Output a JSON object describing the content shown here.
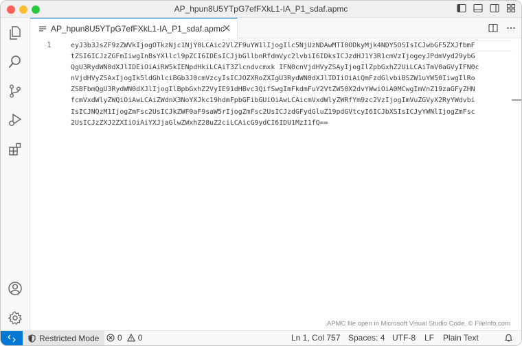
{
  "window": {
    "title": "AP_hpun8U5YTpG7efFXkL1-IA_P1_sdaf.apmc"
  },
  "tab": {
    "label": "AP_hpun8U5YTpG7efFXkL1-IA_P1_sdaf.apmc"
  },
  "editor": {
    "line_number": "1",
    "lines": [
      "eyJ3b3JsZF9zZWVkIjogOTkzNjc1NjY0LCAic2VlZF9uYW1lIjogIlc5NjUzNDAwMTI0ODkyMjk4NDY5OSIsICJwbGF5ZXJfbmF",
      "tZSI6ICJzZGFmIiwgInBsYXllcl9pZCI6IDEsICJjbGllbnRfdmVyc2lvbiI6IDksICJzdHJ1Y3R1cmVzIjogeyJPdmVyd29ybG",
      "QgU3RydWN0dXJlIDEiOiAiRW5kIENpdHkiLCAiT3Zlcndvcmxk IFN0cnVjdHVyZSAyIjogIlZpbGxhZ2UiLCAiTmV0aGVyIFN0c",
      "nVjdHVyZSAxIjogIk5ldGhlciBGb3J0cmVzcyIsICJOZXRoZXIgU3RydWN0dXJlIDIiOiAiQmFzdGlvbiBSZW1uYW50IiwgIlRo",
      "ZSBFbmQgU3RydWN0dXJlIjogIlBpbGxhZ2VyIE91dHBvc3QifSwgImFkdmFuY2VtZW50X2dvYWwiOiA0MCwgImVnZ19zaGFyZHN",
      "fcmVxdWlyZWQiOiAwLCAiZWdnX3NoYXJkc19hdmFpbGFibGUiOiAwLCAicmVxdWlyZWRfYm9zc2VzIjogImVuZGVyX2RyYWdvbi",
      "IsICJNQzM1IjogZmFsc2UsICJkZWF0aF9saW5rIjogZmFsc2UsICJzdGFydGluZ19pdGVtcyI6ICJbXSIsICJyYWNlIjogZmFsc",
      "2UsICJzZXJ2ZXIiOiAiYXJjaGlwZWxhZ28uZ2ciLCAicG9ydCI6IDU1MzI1fQ=="
    ],
    "watermark": ".APMC file open in Microsoft Visual Studio Code. © FileInfo.com"
  },
  "statusbar": {
    "restricted_mode": "Restricted Mode",
    "errors": "0",
    "warnings": "0",
    "position": "Ln 1, Col 757",
    "spaces": "Spaces: 4",
    "encoding": "UTF-8",
    "eol": "LF",
    "language": "Plain Text"
  },
  "colors": {
    "accent": "#0078d4",
    "close": "#fe5f57",
    "minimize": "#febc2e",
    "maximize": "#28c840"
  },
  "icons": {
    "activity": [
      "explorer-icon",
      "search-icon",
      "source-control-icon",
      "run-debug-icon",
      "extensions-icon",
      "account-icon",
      "manage-gear-icon"
    ]
  }
}
